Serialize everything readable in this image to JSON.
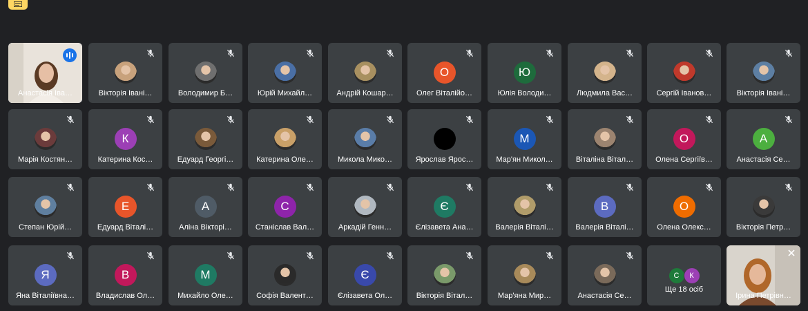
{
  "participants": [
    {
      "name": "Анастасія Іва…",
      "type": "video",
      "speaking": true
    },
    {
      "name": "Вікторія Івані…",
      "type": "photo",
      "color": "#c8a27c"
    },
    {
      "name": "Володимир Б…",
      "type": "photo",
      "color": "#6f6f6f"
    },
    {
      "name": "Юрій Михайл…",
      "type": "photo",
      "color": "#4a6fa5"
    },
    {
      "name": "Андрій Кошар…",
      "type": "photo",
      "color": "#a89060"
    },
    {
      "name": "Олег Віталійо…",
      "type": "initial",
      "initial": "О",
      "color": "#e8552a"
    },
    {
      "name": "Юлія Володи…",
      "type": "initial",
      "initial": "Ю",
      "color": "#1e6b3c"
    },
    {
      "name": "Людмила Вас…",
      "type": "photo",
      "color": "#d4b48c"
    },
    {
      "name": "Сергій Іванов…",
      "type": "photo",
      "color": "#c0392b"
    },
    {
      "name": "Вікторія Івані…",
      "type": "photo",
      "color": "#5d7fa3"
    },
    {
      "name": "Марія Костян…",
      "type": "photo",
      "color": "#6b3b3b"
    },
    {
      "name": "Катерина Кос…",
      "type": "initial",
      "initial": "К",
      "color": "#9c3fb5"
    },
    {
      "name": "Едуард Георгі…",
      "type": "photo",
      "color": "#7a5a3a"
    },
    {
      "name": "Катерина Оле…",
      "type": "photo",
      "color": "#c9a068"
    },
    {
      "name": "Микола Мико…",
      "type": "photo",
      "color": "#5a7da8"
    },
    {
      "name": "Ярослав Ярос…",
      "type": "initial",
      "initial": "",
      "color": "#000000"
    },
    {
      "name": "Мар'ян Микол…",
      "type": "initial",
      "initial": "М",
      "color": "#1b57b5"
    },
    {
      "name": "Віталіна Вітал…",
      "type": "photo",
      "color": "#9c8470"
    },
    {
      "name": "Олена Сергіїв…",
      "type": "initial",
      "initial": "О",
      "color": "#c2185b"
    },
    {
      "name": "Анастасія Се…",
      "type": "initial",
      "initial": "А",
      "color": "#4caf3f"
    },
    {
      "name": "Степан Юрій…",
      "type": "photo",
      "color": "#5f7f9f"
    },
    {
      "name": "Едуард Віталі…",
      "type": "initial",
      "initial": "Е",
      "color": "#e8552a"
    },
    {
      "name": "Аліна Вікторі…",
      "type": "initial",
      "initial": "А",
      "color": "#4f5b66"
    },
    {
      "name": "Станіслав Вал…",
      "type": "initial",
      "initial": "С",
      "color": "#8e24aa"
    },
    {
      "name": "Аркадій Генн…",
      "type": "photo",
      "color": "#b0b8c0"
    },
    {
      "name": "Єлізавета Ана…",
      "type": "initial",
      "initial": "Є",
      "color": "#1f7a63"
    },
    {
      "name": "Валерія Віталі…",
      "type": "photo",
      "color": "#b09c6a"
    },
    {
      "name": "Валерія Віталі…",
      "type": "initial",
      "initial": "В",
      "color": "#5c6bc0"
    },
    {
      "name": "Олена Олекс…",
      "type": "initial",
      "initial": "О",
      "color": "#ef6c00"
    },
    {
      "name": "Вікторія Петр…",
      "type": "photo",
      "color": "#3a3a3a"
    },
    {
      "name": "Яна Віталіївна…",
      "type": "initial",
      "initial": "Я",
      "color": "#5c6bc0"
    },
    {
      "name": "Владислав Ол…",
      "type": "initial",
      "initial": "В",
      "color": "#c2185b"
    },
    {
      "name": "Михайло Оле…",
      "type": "initial",
      "initial": "М",
      "color": "#1f7a63"
    },
    {
      "name": "Софія Валент…",
      "type": "photo",
      "color": "#2a2a2a"
    },
    {
      "name": "Єлізавета Ол…",
      "type": "initial",
      "initial": "Є",
      "color": "#3949ab"
    },
    {
      "name": "Вікторія Вітал…",
      "type": "photo",
      "color": "#7a9a6a"
    },
    {
      "name": "Мар'яна Мир…",
      "type": "photo",
      "color": "#a88a5a"
    },
    {
      "name": "Анастасія Се…",
      "type": "photo",
      "color": "#7a6a5a"
    },
    {
      "name": "Ще 18 осіб",
      "type": "more",
      "avatars": [
        {
          "initial": "С",
          "color": "#1e7b3a"
        },
        {
          "initial": "К",
          "color": "#9c3fb5"
        }
      ]
    },
    {
      "name": "Ірина Петрівн…",
      "type": "video2"
    }
  ]
}
